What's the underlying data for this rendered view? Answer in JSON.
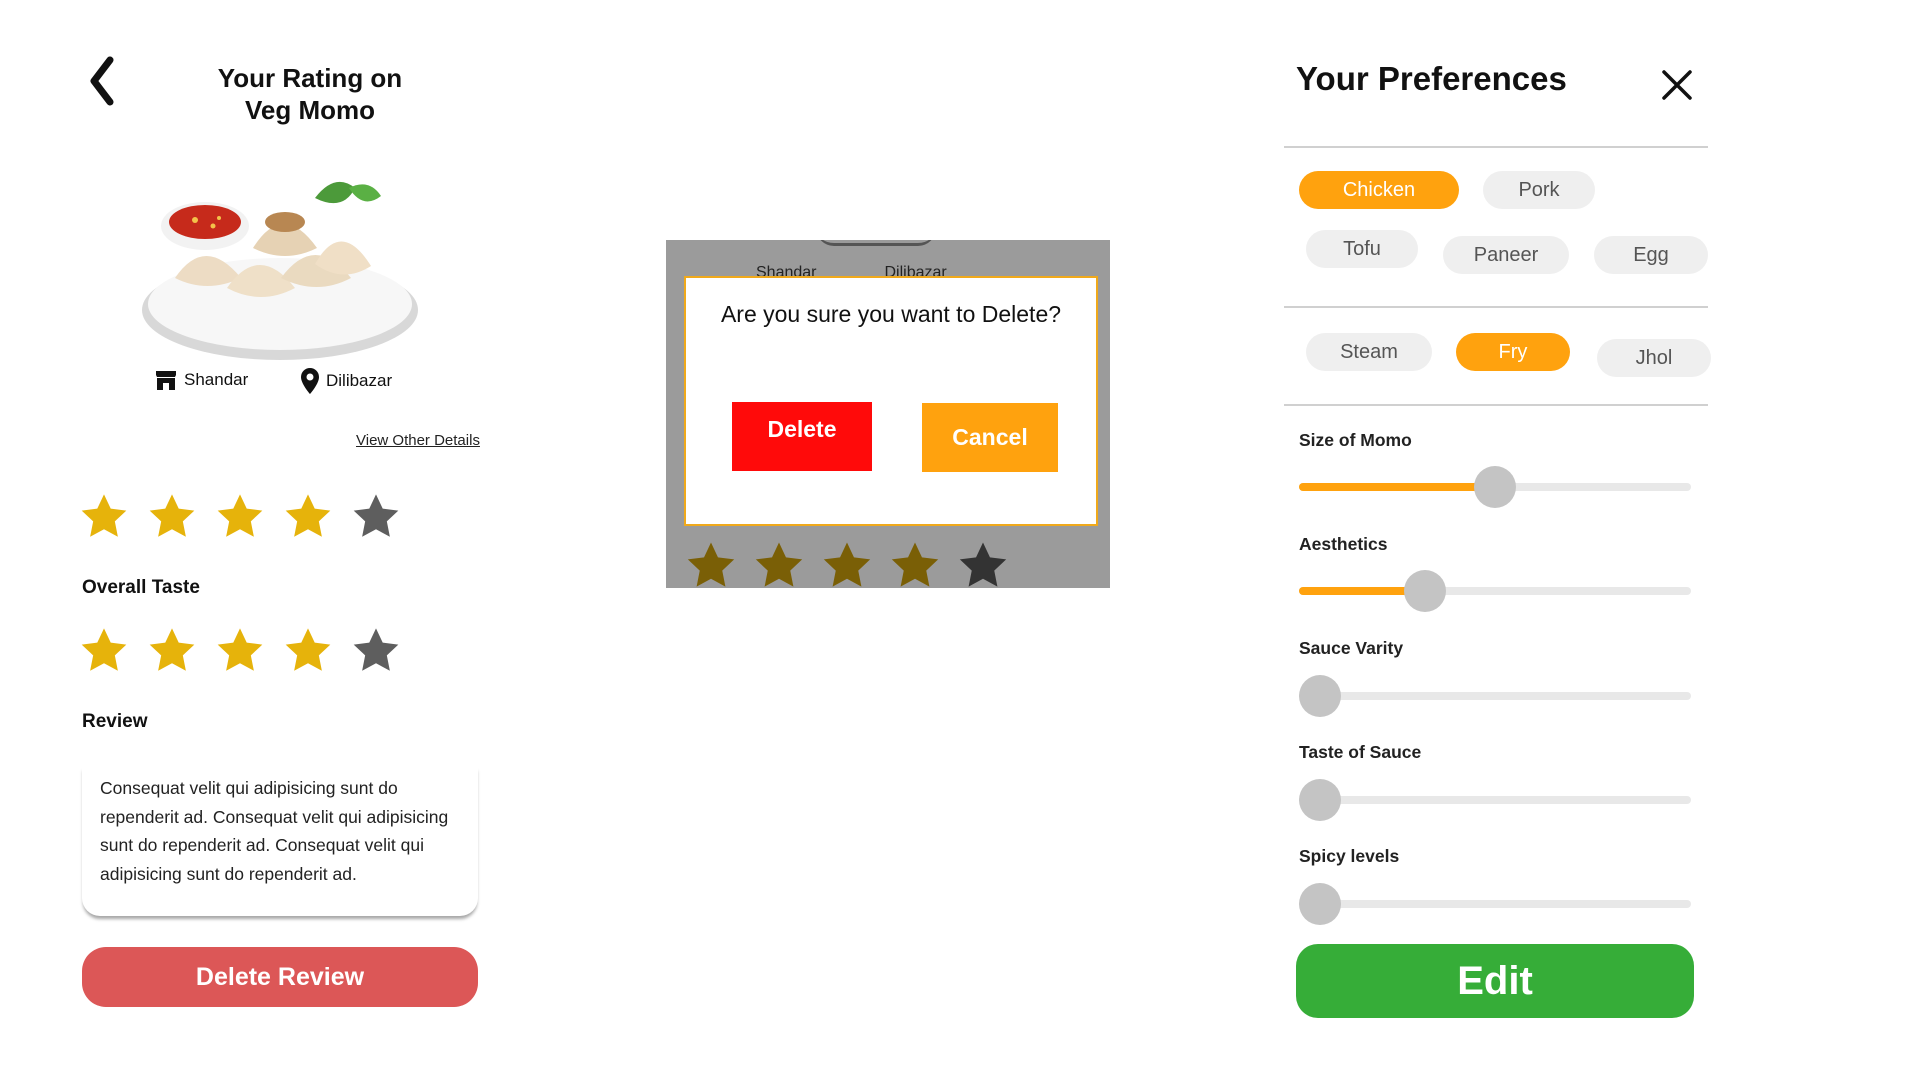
{
  "rating_screen": {
    "title_line1": "Your Rating on",
    "title_line2": "Veg Momo",
    "shop_name": "Shandar",
    "location": "Dilibazar",
    "view_details": "View Other Details",
    "rating_1": 4,
    "rating_taste": 4,
    "max_rating": 5,
    "taste_label": "Overall Taste",
    "review_label": "Review",
    "review_text": "Consequat velit qui adipisicing sunt do rependerit ad. Consequat velit qui adipisicing sunt do rependerit ad. Consequat velit qui adipisicing sunt do rependerit ad.",
    "delete_review": "Delete Review"
  },
  "delete_dialog": {
    "message": "Are you sure you want to Delete?",
    "delete_label": "Delete",
    "cancel_label": "Cancel",
    "background_rating": 4
  },
  "preferences": {
    "title": "Your Preferences",
    "meat_chips": [
      {
        "label": "Chicken",
        "selected": true
      },
      {
        "label": "Pork",
        "selected": false
      },
      {
        "label": "Tofu",
        "selected": false
      },
      {
        "label": "Paneer",
        "selected": false
      },
      {
        "label": "Egg",
        "selected": false
      }
    ],
    "style_chips": [
      {
        "label": "Steam",
        "selected": false
      },
      {
        "label": "Fry",
        "selected": true
      },
      {
        "label": "Jhol",
        "selected": false
      }
    ],
    "sliders": [
      {
        "label": "Size of Momo",
        "value": 0.5
      },
      {
        "label": "Aesthetics",
        "value": 0.3
      },
      {
        "label": "Sauce Varity",
        "value": 0.0
      },
      {
        "label": "Taste of Sauce",
        "value": 0.0
      },
      {
        "label": "Spicy levels",
        "value": 0.0
      }
    ],
    "edit_label": "Edit"
  },
  "colors": {
    "star_on": "#e6b30b",
    "star_off": "#5e5e5e",
    "accent": "#ffa20e",
    "danger": "#ff0a0a",
    "edit": "#36ad38",
    "delete_review": "#dc5757"
  }
}
